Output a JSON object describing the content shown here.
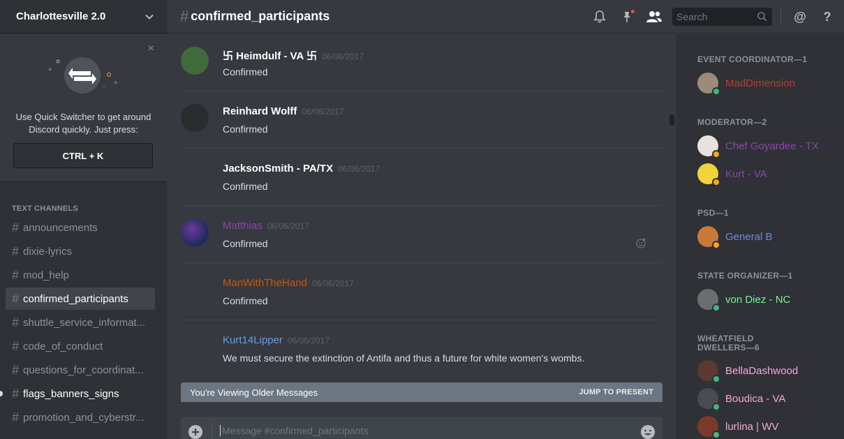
{
  "server": {
    "name": "Charlottesville 2.0"
  },
  "quick_switcher": {
    "text_line1": "Use Quick Switcher to get around",
    "text_line2": "Discord quickly. Just press:",
    "shortcut": "CTRL + K",
    "close": "×"
  },
  "channels": {
    "category": "TEXT CHANNELS",
    "items": [
      {
        "name": "announcements",
        "state": "normal"
      },
      {
        "name": "dixie-lyrics",
        "state": "normal"
      },
      {
        "name": "mod_help",
        "state": "normal"
      },
      {
        "name": "confirmed_participants",
        "state": "active"
      },
      {
        "name": "shuttle_service_informat...",
        "state": "normal"
      },
      {
        "name": "code_of_conduct",
        "state": "normal"
      },
      {
        "name": "questions_for_coordinat...",
        "state": "normal"
      },
      {
        "name": "flags_banners_signs",
        "state": "unread"
      },
      {
        "name": "promotion_and_cyberstr...",
        "state": "normal"
      }
    ]
  },
  "header": {
    "hash": "#",
    "channel": "confirmed_participants",
    "search_placeholder": "Search",
    "at": "@",
    "help": "?"
  },
  "messages": [
    {
      "user": "卐 Heimdulf - VA 卐",
      "color": "#ffffff",
      "time": "06/06/2017",
      "text": "Confirmed",
      "avatar": "#3f6b3a"
    },
    {
      "user": "Reinhard Wolff",
      "color": "#ffffff",
      "time": "06/06/2017",
      "text": "Confirmed",
      "avatar": "#2a2b2d"
    },
    {
      "user": "JacksonSmith - PA/TX",
      "color": "#ffffff",
      "time": "06/06/2017",
      "text": "Confirmed",
      "avatar": ""
    },
    {
      "user": "Matthias",
      "color": "#8e44ad",
      "time": "06/06/2017",
      "text": "Confirmed",
      "avatar": "#2b3a6b"
    },
    {
      "user": "ManWithTheHand",
      "color": "#d35400",
      "time": "06/06/2017",
      "text": "Confirmed",
      "avatar": ""
    },
    {
      "user": "Kurt14Lipper",
      "color": "#5e9fe8",
      "time": "06/06/2017",
      "text": "We must secure the extinction of Antifa and thus a future for white women's wombs.",
      "avatar": ""
    }
  ],
  "older_bar": {
    "text": "You're Viewing Older Messages",
    "jump": "JUMP TO PRESENT"
  },
  "composer": {
    "placeholder": "Message #confirmed_participants"
  },
  "members": {
    "roles": [
      {
        "title": "EVENT COORDINATOR—1",
        "members": [
          {
            "name": "MadDimension",
            "color": "#c0392b",
            "status": "#43b581",
            "avatar": "#9b8b78"
          }
        ]
      },
      {
        "title": "MODERATOR—2",
        "members": [
          {
            "name": "Chef Goyardee - TX",
            "color": "#8e44ad",
            "status": "#faa61a",
            "avatar": "#e8e1dc"
          },
          {
            "name": "Kurt - VA",
            "color": "#8e44ad",
            "status": "#faa61a",
            "avatar": "#f1d33a"
          }
        ]
      },
      {
        "title": "PSD—1",
        "members": [
          {
            "name": "General B",
            "color": "#7289da",
            "status": "#faa61a",
            "avatar": "#c97a3a"
          }
        ]
      },
      {
        "title": "STATE ORGANIZER—1",
        "members": [
          {
            "name": "von Diez - NC",
            "color": "#77f29a",
            "status": "#43b581",
            "avatar": "#6b6d70"
          }
        ]
      },
      {
        "title": "WHEATFIELD DWELLERS—6",
        "members": [
          {
            "name": "BellaDashwood",
            "color": "#f5a9d8",
            "status": "#43b581",
            "avatar": "#5a3a32"
          },
          {
            "name": "Boudica - VA",
            "color": "#f5a9d8",
            "status": "#43b581",
            "avatar": "#4a4a52"
          },
          {
            "name": "lurlina | WV",
            "color": "#f5a9d8",
            "status": "#43b581",
            "avatar": "#7a3a2a"
          }
        ]
      }
    ]
  }
}
